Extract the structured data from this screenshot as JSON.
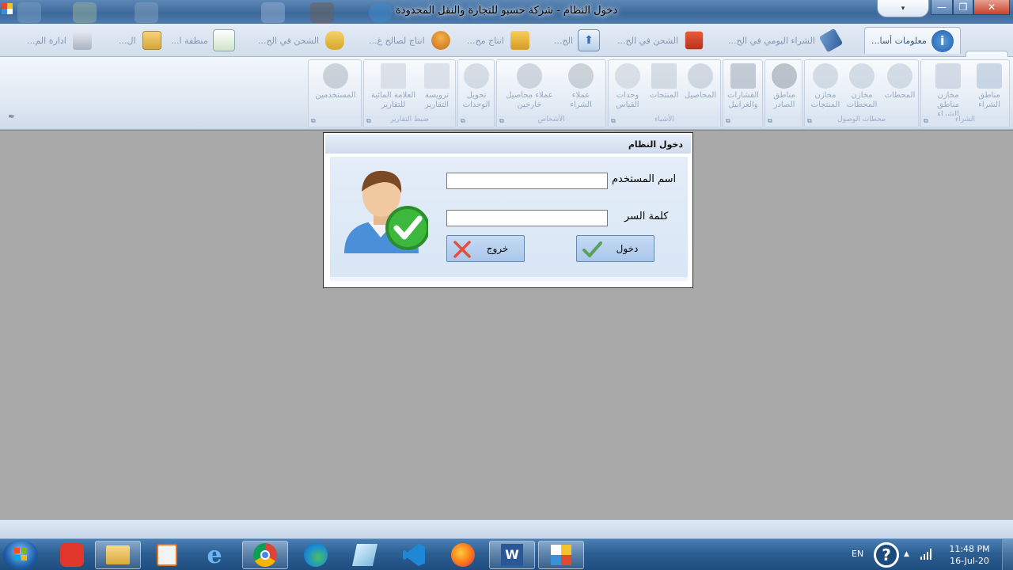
{
  "window": {
    "title": "دخول النظام - شركة حسبو للتجارة والنقل المحدودة",
    "quick_access": "▾",
    "buttons": [
      "—",
      "❐",
      "✕"
    ]
  },
  "ribbon": {
    "tabs": [
      "معلومات أسا...",
      "الشراء اليومي في الح...",
      "الشحن في الح...",
      "الح...",
      "انتاج مح...",
      "انتاج لصالح غ...",
      "الشحن في الح...",
      "منطقة ا...",
      "ال...",
      "ادارة الم..."
    ],
    "groups": [
      {
        "label": "الشراء",
        "buttons": [
          "مناطق الشراء",
          "مخازن مناطق الشراء"
        ]
      },
      {
        "label": "محطات الوصول",
        "buttons": [
          "المحطات",
          "مخازن المحطات",
          "مخازن المنتجات"
        ]
      },
      {
        "label": "",
        "buttons": [
          "مناطق الصادر"
        ]
      },
      {
        "label": "",
        "buttons": [
          "القشارات والغرابيل"
        ]
      },
      {
        "label": "الأشياء",
        "buttons": [
          "المحاصيل",
          "المنتجات",
          "وحدات القياس"
        ]
      },
      {
        "label": "الأشخاص",
        "buttons": [
          "عملاء الشراء",
          "عملاء محاصيل خارجين"
        ]
      },
      {
        "label": "",
        "buttons": [
          "تحويل الوحدات"
        ]
      },
      {
        "label": "ضبط التقارير",
        "buttons": [
          "ترويسة التقارير",
          "العلامة المائية للتقارير"
        ]
      },
      {
        "label": "",
        "buttons": [
          "المستخدمين"
        ]
      }
    ],
    "collapse": "≈"
  },
  "dialog": {
    "title": "دخول النظام",
    "username_label": "اسم المستخدم",
    "username_value": "",
    "password_label": "كلمة السر",
    "password_value": "",
    "login_button": "دخول",
    "exit_button": "خروج"
  },
  "taskbar": {
    "language": "EN",
    "time": "11:48 PM",
    "date": "16-Jul-20",
    "help": "?",
    "tray_arrow": "▲"
  },
  "colors": {
    "workspace": "#a9a9a9",
    "dialog_body": "#dde9f6",
    "button": "#b8d0ef",
    "taskbar": "#2d5f93"
  }
}
